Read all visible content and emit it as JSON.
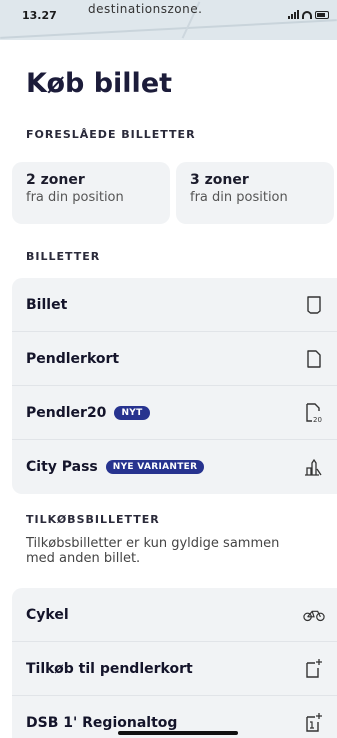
{
  "status_bar": {
    "time": "13.27",
    "banner_text": "destinationszone."
  },
  "page": {
    "title": "Køb billet"
  },
  "suggested": {
    "heading": "FORESLÅEDE BILLETTER",
    "cards": [
      {
        "zones": "2 zoner",
        "subtitle": "fra din position"
      },
      {
        "zones": "3 zoner",
        "subtitle": "fra din position"
      }
    ]
  },
  "tickets": {
    "heading": "BILLETTER",
    "items": [
      {
        "label": "Billet",
        "badge": "",
        "icon": "ticket-icon"
      },
      {
        "label": "Pendlerkort",
        "badge": "",
        "icon": "card-icon"
      },
      {
        "label": "Pendler20",
        "badge": "NYT",
        "icon": "pendler20-icon"
      },
      {
        "label": "City Pass",
        "badge": "NYE VARIANTER",
        "icon": "city-pass-icon"
      }
    ]
  },
  "addons": {
    "heading": "TILKØBSBILLETTER",
    "description": "Tilkøbsbilletter er kun gyldige sammen med anden billet.",
    "items": [
      {
        "label": "Cykel",
        "icon": "bicycle-icon"
      },
      {
        "label": "Tilkøb til pendlerkort",
        "icon": "card-plus-icon"
      },
      {
        "label": "DSB 1' Regionaltog",
        "icon": "first-class-plus-icon"
      }
    ]
  },
  "colors": {
    "badge_bg": "#27338f",
    "card_bg": "#f1f3f5",
    "title": "#1c1c3a"
  }
}
